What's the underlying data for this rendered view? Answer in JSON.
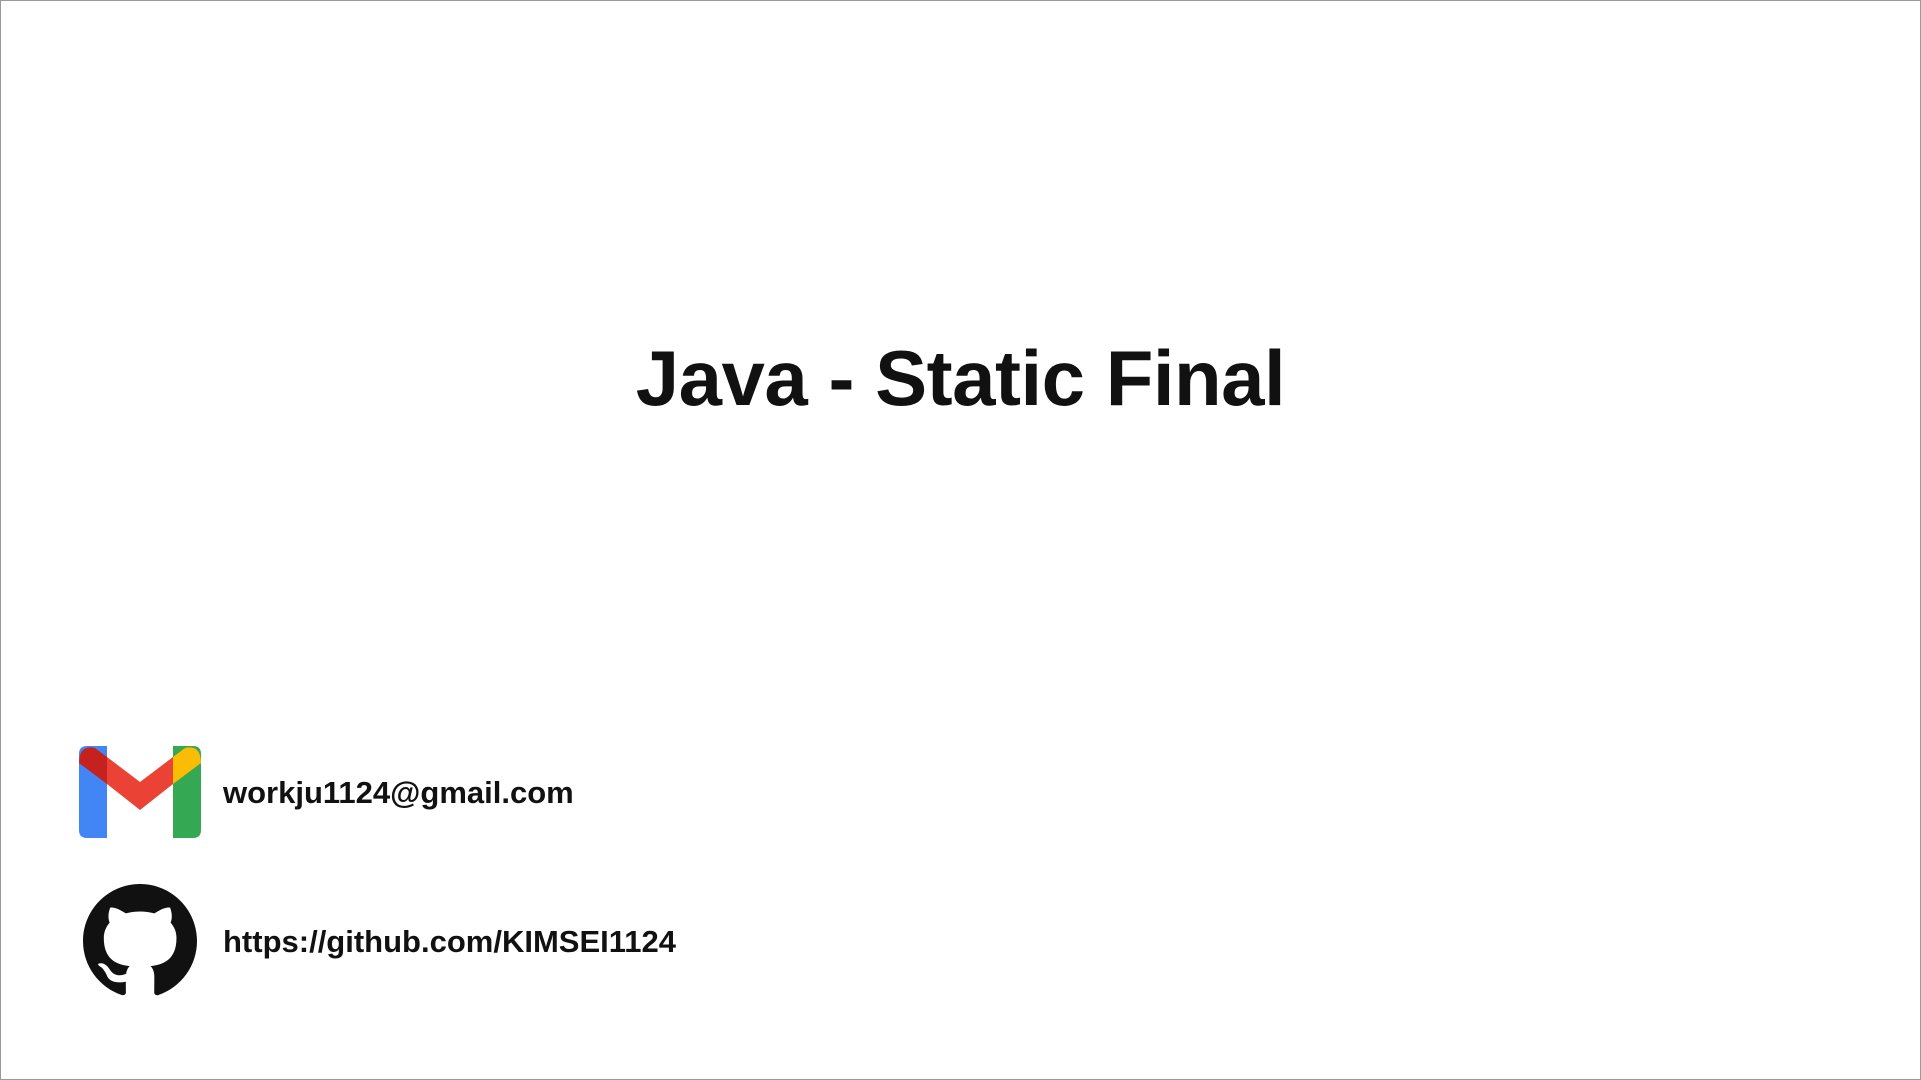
{
  "slide": {
    "title": "Java - Static Final"
  },
  "contacts": {
    "email": {
      "icon": "gmail-icon",
      "text": "workju1124@gmail.com"
    },
    "github": {
      "icon": "github-icon",
      "text": "https://github.com/KIMSEI1124"
    }
  },
  "colors": {
    "background": "#ffffff",
    "text": "#111111",
    "gmail_red": "#EA4335",
    "gmail_dark_red": "#C5221F",
    "gmail_blue": "#4285F4",
    "gmail_green": "#34A853",
    "gmail_yellow": "#FBBC04",
    "github_black": "#111111"
  }
}
